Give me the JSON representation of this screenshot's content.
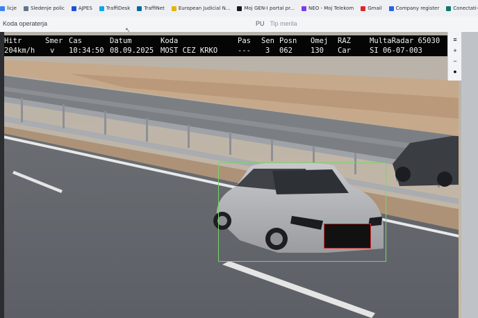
{
  "bookmarks": [
    {
      "label": "licje",
      "color": "#3b82f6"
    },
    {
      "label": "Sledenje polic",
      "color": "#64748b"
    },
    {
      "label": "AJPES",
      "color": "#1d4ed8"
    },
    {
      "label": "TraffiDesk",
      "color": "#0ea5e9"
    },
    {
      "label": "TraffiNet",
      "color": "#0369a1"
    },
    {
      "label": "European Judicial N...",
      "color": "#eab308"
    },
    {
      "label": "Moj GEN-I portal pr...",
      "color": "#111827"
    },
    {
      "label": "NEO - Moj Telekom",
      "color": "#7c3aed"
    },
    {
      "label": "Gmail",
      "color": "#dc2626"
    },
    {
      "label": "Company register",
      "color": "#2563eb"
    },
    {
      "label": "Conectati-va la Offici...",
      "color": "#0f766e"
    }
  ],
  "toolbar": {
    "title": "Koda operaterja",
    "pu": "PU",
    "tip_merila": "Tip merila"
  },
  "overlay": {
    "h_hitr": "Hitr",
    "h_smer": "Smer",
    "h_cas": "Cas",
    "h_datum": "Datum",
    "h_koda": "Koda",
    "h_pas": "Pas",
    "h_sen": "Sen",
    "h_posn": "Posn",
    "h_omej": "Omej",
    "h_raz": "RAZ",
    "h_device": "MultaRadar 65030",
    "v_hitr": "204km/h",
    "v_smer": "v",
    "v_cas": "10:34:50",
    "v_datum": "08.09.2025",
    "v_koda": "MOST CEZ KRKO",
    "v_pas": "---",
    "v_sen": "3",
    "v_posn": "062",
    "v_omej": "130",
    "v_raz": "Car",
    "v_device_id": "SI 06-07-003"
  },
  "side_panel_icons": [
    "menu-icon",
    "zoom-in-icon",
    "zoom-out-icon",
    "drop-icon"
  ],
  "colors": {
    "detection_box": "#7bd36b",
    "plate_box": "#d73030"
  }
}
